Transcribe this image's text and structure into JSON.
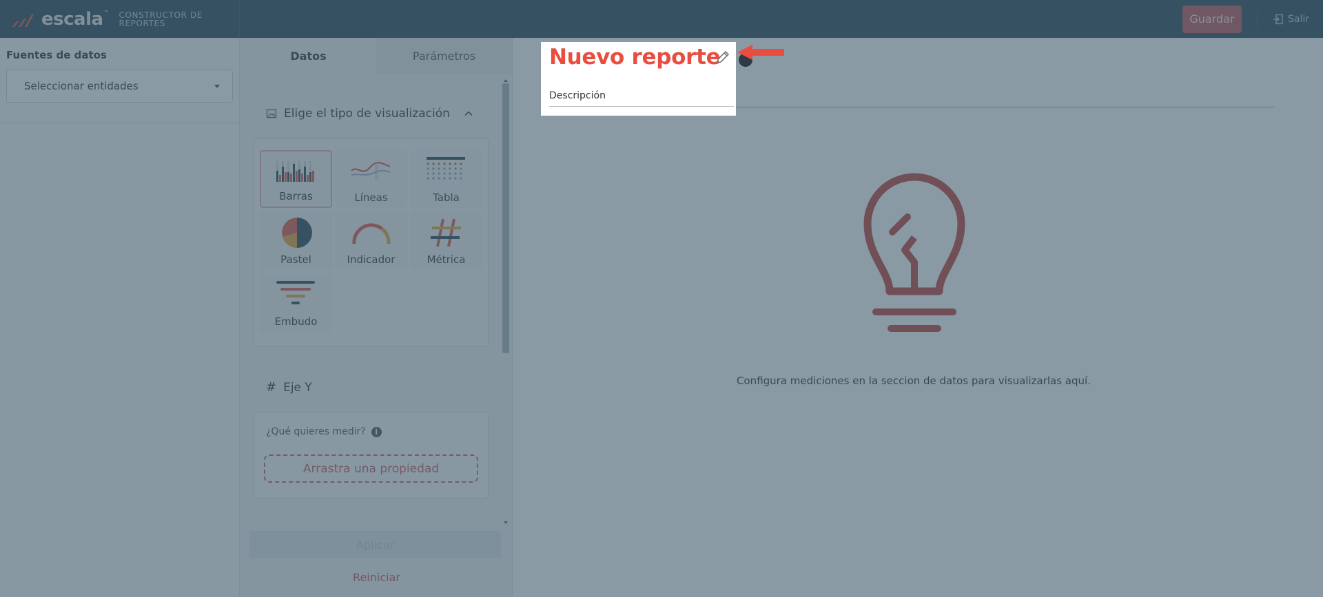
{
  "header": {
    "brand": "escala",
    "brand_tm": "™",
    "subtitle_line1": "CONSTRUCTOR DE",
    "subtitle_line2": "REPORTES",
    "save_label": "Guardar",
    "exit_label": "Salir",
    "save_color": "#bd5b5c"
  },
  "left": {
    "title": "Fuentes de datos",
    "select_label": "Seleccionar entidades"
  },
  "middle": {
    "tabs": [
      {
        "label": "Datos",
        "active": true
      },
      {
        "label": "Parámetros",
        "active": false
      }
    ],
    "viz_section_title": "Elige el tipo de visualización",
    "viz_types": [
      {
        "label": "Barras",
        "icon": "bar-chart-icon",
        "selected": true
      },
      {
        "label": "Líneas",
        "icon": "line-chart-icon",
        "selected": false
      },
      {
        "label": "Tabla",
        "icon": "table-icon",
        "selected": false
      },
      {
        "label": "Pastel",
        "icon": "pie-chart-icon",
        "selected": false
      },
      {
        "label": "Indicador",
        "icon": "gauge-icon",
        "selected": false
      },
      {
        "label": "Métrica",
        "icon": "hash-icon",
        "selected": false
      },
      {
        "label": "Embudo",
        "icon": "funnel-icon",
        "selected": false
      }
    ],
    "y_axis_title": "Eje Y",
    "measure_question": "¿Qué quieres medir?",
    "drop_label": "Arrastra una propiedad",
    "apply_label": "Aplicar",
    "reset_label": "Reiniciar"
  },
  "main": {
    "report_title": "Nuevo reporte",
    "description_label": "Descripción",
    "empty_message": "Configura mediciones en la seccion de datos para visualizarlas aquí.",
    "accent_color": "#e94d3f"
  }
}
